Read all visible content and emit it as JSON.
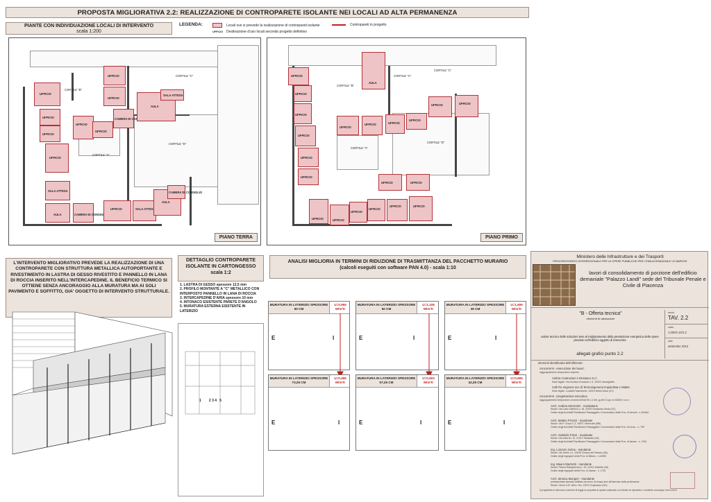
{
  "header": {
    "title": "PROPOSTA MIGLIORATIVA 2.2: REALIZZAZIONE DI CONTROPARETE ISOLANTE NEI LOCALI AD ALTA PERMANENZA"
  },
  "plans": {
    "title": "PIANTE CON INDIVIDUAZIONE LOCALI DI INTERVENTO",
    "scale": "scala 1:200",
    "ground_label": "PIANO TERRA",
    "first_label": "PIANO PRIMO"
  },
  "legend": {
    "label": "LEGENDA:",
    "item1": "Locali ove si prevede la realizzazione di contropareti isolante",
    "item2": "Contropareti in progetto",
    "item3_code": "UFFICIO",
    "item3": "Destinazione d'uso locali secondo progetto definitivo"
  },
  "room_labels": {
    "ufficio": "UFFICIO",
    "aula": "AULA",
    "sala_attesa": "SALA ATTESA",
    "camera": "CAMERA DI CONSIGLIO",
    "cortile_a": "CORTILE \"A\"",
    "cortile_b": "CORTILE \"B\"",
    "cortile_c": "CORTILE \"C\"",
    "cortile_d": "CORTILE \"D\""
  },
  "description": "L'INTERVENTO MIGLIORATIVO PREVEDE LA REALIZZAZIONE DI UNA CONTROPARETE CON STRUTTURA METALLICA AUTOPORTANTE E RIVESTIMENTO IN LASTRA DI GESSO RIVESTITO E PANNELLO IN LANA DI ROCCIA INSERITO NELL'INTERCAPEDINE. IL BENEFICIO TERMICO SI OTTIENE SENZA ANCORAGGIO ALLA MURATURA MA AI SOLI PAVIMENTO E SOFFITTO, GIA' OGGETTO DI INTERVENTO STRUTTURALE.",
  "detail": {
    "title": "DETTAGLIO CONTROPARETE ISOLANTE IN CARTONGESSO",
    "scale": "scala 1:2",
    "items": [
      "1. LASTRA DI GESSO spessore 12,5 mm",
      "2. PROFILO MONTANTE A \"C\" METALLICO CON INTERPOSTO PANNELLO IN LANA DI ROCCIA",
      "3. INTERCAPEDINE D'ARIA spessore 10 mm",
      "4. INTONACO ESISTENTE PARETE D'ANGOLO",
      "5. MURATURA ESTERNA ESISTENTE IN LATERIZIO"
    ],
    "numbers": "1        2 3 4   5"
  },
  "analysis": {
    "title": "ANALISI MIGLIORIA  IN TERMINI DI RIDUZIONE DI TRASMITTANZA DEL PACCHETTO MURARIO",
    "subtitle": "(calcoli eseguiti con software PAN 4.0) - scala 1:10",
    "before": [
      {
        "name": "MURATURA IN LATERIZIO SPESSORE 60 CM",
        "u": "U=0,955 W/m²K"
      },
      {
        "name": "MURATURA IN LATERIZIO SPESSORE 50 CM",
        "u": "U=1,108 W/m²K"
      },
      {
        "name": "MURATURA IN LATERIZIO SPESSORE 35 CM",
        "u": "U=1,606 W/m²K"
      }
    ],
    "after": [
      {
        "name": "MURATURA IN LATERIZIO SPESSORE 73,25 CM",
        "u": "U=0,466 W/m²K"
      },
      {
        "name": "MURATURA IN LATERIZIO SPESSORE 57,25 CM",
        "u": "U=0,503 W/m²K"
      },
      {
        "name": "MURATURA IN LATERIZIO SPESSORE 42,25 CM",
        "u": "U=0,565 W/m²K"
      }
    ],
    "e": "E",
    "i": "I"
  },
  "titleblock": {
    "ministry": "Ministero delle Infrastrutture e dei Trasporti",
    "provveditorato": "PROVVEDITORATO INTERREGIONALE PER LE OPERE PUBBLICHE PER L'EMILIA ROMAGNA E LE MARCHE",
    "project": "lavori di consolidamento di porzione dell'edificio demaniale \"Palazzo Landi\" sede del Tribunale Penale e Civile di Piacenza",
    "offer": "\"B - Offerta tecnica\"",
    "offer_sub": "elementi di valutazione",
    "desc": "valore tecnico delle soluzioni tese al miglioramento della prestazione energetica delle opere previste nell'edificio oggetto di intervento",
    "allegati": "allegati grafici punto 2.2",
    "tav_label": "tavola",
    "tav": "TAV. 2.2",
    "scale_label": "scala",
    "scale": "1:200/1:10/1:2",
    "date_label": "data",
    "date": "settembre 2013",
    "section1": "elementi identificativi dell'offerente:",
    "concorrenti_exec": "concorrenti - esecuzione dei lavori:",
    "exec_note": "raggruppamento temporaneo imprese",
    "firm1": "Ambra Costruzioni e Restauro S.r.l.",
    "firm1_sub": "Sede legale: Via Gustavo Drovandi n. 5, 20020 Vanzaghello",
    "firm2": "Colli Re mignone soc di Termoingeneria Impiantista e Walter",
    "firm2_sub": "Sede legale: Località Paseranello, 10019 Nebbi Sesia (VC)",
    "concorrenti_prog": "concorrenti - progettazione esecutiva",
    "prog_note": "raggruppamento temporaneo ai sensi dell'art.90 c.1 lett. g) del D.Lgs nr.163/06 e s.m.i.",
    "people": [
      {
        "name": "Arch. Andrea Mozzarini - mandatario",
        "sub": "Studio: Via Carlo Solferino n. 18, 20020 Somaredo Sesia (VC)",
        "sub2": "Ordine degli Architetti Pianificatori Paesaggisti e Conservatori della Prov. di Vercelli - n.434/AU"
      },
      {
        "name": "Arch. Matteo Picozzi - mandante",
        "sub": "Studio: Via P. Crivpi n. 3, 20871 Vimercate (MB)",
        "sub2": "Ordine degli Architetti Pianificatori Paesaggisti e Conservatori della Prov. di Lecco - n. 799"
      },
      {
        "name": "Arch. Gabriele Pozzi - mandante",
        "sub": "Studio: Via Volta 5n. 12, 21017 Samarate (VA)",
        "sub2": "Ordine degli Architetti Pianificatori Paesaggisti e Conservatori della Prov. di Varese - n. 1784"
      },
      {
        "name": "Ing. Lorenzo Jurina - mandante",
        "sub": "Studio: Via Trento n.1, 20090 Cesano del Pascolo (MI)",
        "sub2": "Ordine degli Ingegneri della Prov. di Milano - n.14983"
      },
      {
        "name": "Ing. Mauro Mazzetti - mandante",
        "sub": "Studio: Piazza Risorgimento n. 15, 21012 Soldette (VA)",
        "sub2": "Ordine degli Ingegneri della Prov. di Varese - n. 1791"
      },
      {
        "name": "Arch. Monica Mongeri - mandante",
        "sub": "professionista laureato abilitato da meno di cinque anni all'esercizio della professione",
        "sub2": "Studio: Vicolo G.B. Velli n. 8/c, 20072 Gripinasco (NO)"
      }
    ],
    "footer": "Il progettista si riservano a termini di legge la proprietà di questo elaborato con divieto di riprodurlo o renderlo comunque noto a terzi"
  },
  "colors": {
    "beige": "#ece3dc",
    "pink": "#efc4c6",
    "red": "#c02020"
  }
}
